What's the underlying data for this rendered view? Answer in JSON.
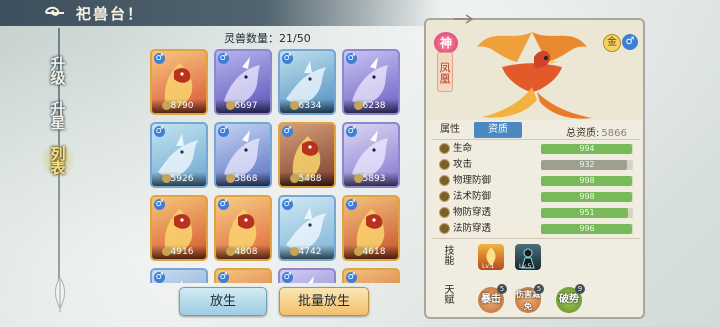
{
  "header": {
    "title": "祀兽台！"
  },
  "nav": {
    "items": [
      {
        "label": "升级"
      },
      {
        "label": "升星"
      },
      {
        "label": "列表"
      }
    ]
  },
  "grid": {
    "count_label": "灵兽数量：21/50",
    "cards": [
      {
        "value": "8790",
        "sex": "♂"
      },
      {
        "value": "6697",
        "sex": "♂"
      },
      {
        "value": "6334",
        "sex": "♂"
      },
      {
        "value": "6238",
        "sex": "♂"
      },
      {
        "value": "5926",
        "sex": "♂"
      },
      {
        "value": "5868",
        "sex": "♂"
      },
      {
        "value": "5488",
        "sex": "♂"
      },
      {
        "value": "5893",
        "sex": "♂"
      },
      {
        "value": "4916",
        "sex": "♂"
      },
      {
        "value": "4808",
        "sex": "♂"
      },
      {
        "value": "4742",
        "sex": "♂"
      },
      {
        "value": "4618",
        "sex": "♂"
      },
      {
        "value": "",
        "sex": "♂"
      },
      {
        "value": "",
        "sex": "♂"
      },
      {
        "value": "",
        "sex": "♂"
      },
      {
        "value": "",
        "sex": "♂"
      }
    ]
  },
  "buttons": {
    "release": "放生",
    "batch_release": "批量放生"
  },
  "detail": {
    "grade": "神",
    "name": "凤凰",
    "gold_badge": "金",
    "sex": "♂",
    "tab_attributes": "属性",
    "tab_aptitude": "资质",
    "total_label": "总资质:",
    "total_value": "5866",
    "stats": [
      {
        "label": "生命",
        "value": "994",
        "fill": 0.99
      },
      {
        "label": "攻击",
        "value": "932",
        "fill": 0.93
      },
      {
        "label": "物理防御",
        "value": "998",
        "fill": 0.99
      },
      {
        "label": "法术防御",
        "value": "998",
        "fill": 0.99
      },
      {
        "label": "物防穿透",
        "value": "951",
        "fill": 0.95
      },
      {
        "label": "法防穿透",
        "value": "996",
        "fill": 0.99
      }
    ],
    "skills_label": "技能",
    "skills": [
      {
        "level": "Lv.1"
      },
      {
        "level": "Lv.5"
      }
    ],
    "talents_label": "天赋",
    "talents": [
      {
        "label": "暴击",
        "count": "5"
      },
      {
        "label": "伤害减免",
        "count": "5"
      },
      {
        "label": "破势",
        "count": "9"
      }
    ]
  }
}
